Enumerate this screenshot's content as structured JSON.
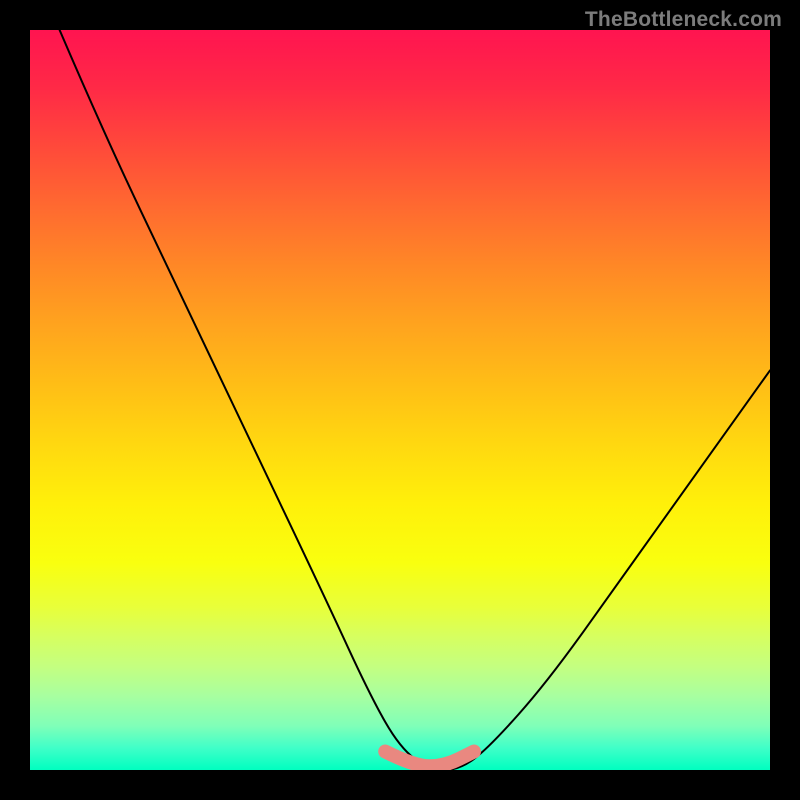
{
  "watermark": "TheBottleneck.com",
  "chart_data": {
    "type": "line",
    "title": "",
    "xlabel": "",
    "ylabel": "",
    "xlim": [
      0,
      100
    ],
    "ylim": [
      0,
      100
    ],
    "series": [
      {
        "name": "curve",
        "x": [
          4,
          10,
          20,
          30,
          40,
          46,
          50,
          54,
          58,
          62,
          70,
          80,
          90,
          100
        ],
        "values": [
          100,
          86,
          65,
          44,
          23,
          10,
          3,
          0,
          0,
          3,
          12,
          26,
          40,
          54
        ]
      },
      {
        "name": "minimum-band",
        "x": [
          48,
          52,
          56,
          60
        ],
        "values": [
          2.5,
          0.5,
          0.5,
          2.5
        ]
      }
    ],
    "colors": {
      "gradient_top": "#ff1450",
      "gradient_bottom": "#00ffc0",
      "curve": "#000000",
      "min_band": "#e98880",
      "frame": "#000000"
    }
  }
}
